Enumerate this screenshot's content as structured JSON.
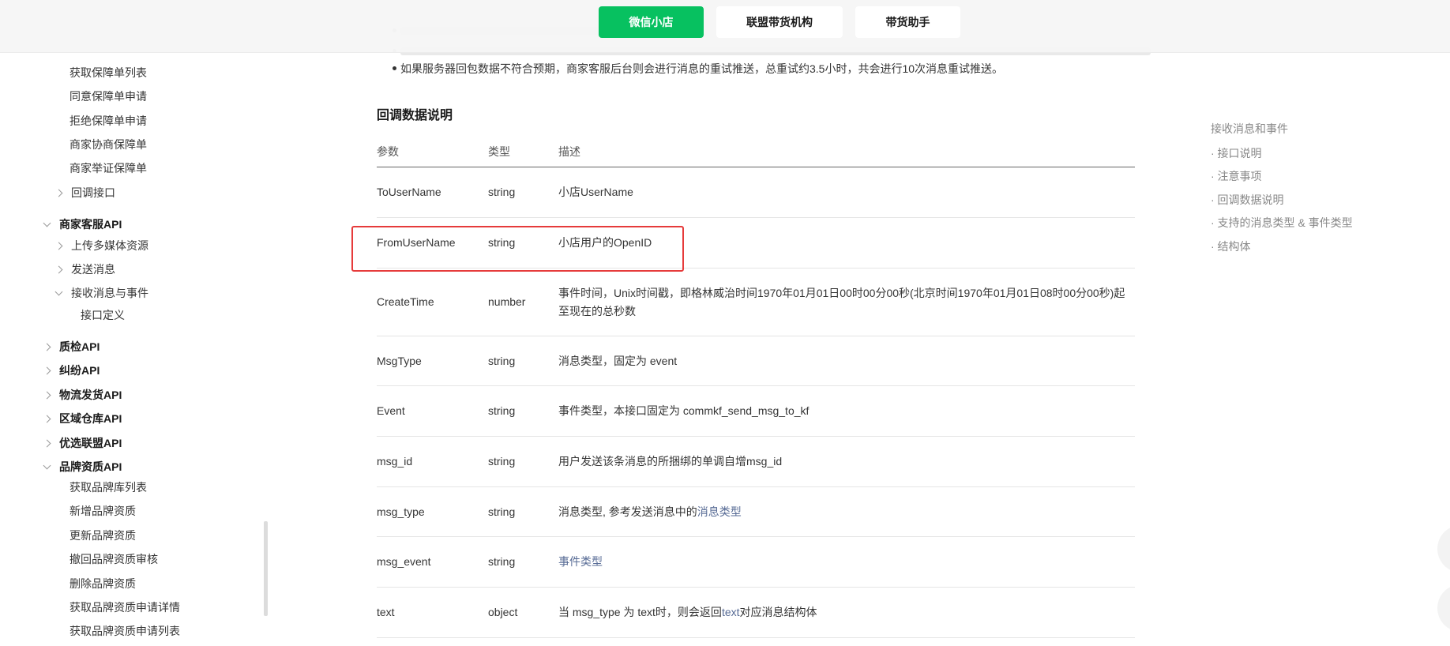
{
  "top_tabs": [
    {
      "label": "微信小店",
      "active": true
    },
    {
      "label": "联盟带货机构",
      "active": false
    },
    {
      "label": "带货助手",
      "active": false
    }
  ],
  "intro": {
    "last_bullet": "如果服务器回包数据不符合预期，商家客服后台则会进行消息的重试推送，总重试约3.5小时，共会进行10次消息重试推送。"
  },
  "sidebar": {
    "items": [
      {
        "label": "获取保障单列表"
      },
      {
        "label": "同意保障单申请"
      },
      {
        "label": "拒绝保障单申请"
      },
      {
        "label": "商家协商保障单"
      },
      {
        "label": "商家举证保障单"
      },
      {
        "label": "回调接口"
      },
      {
        "label": "商家客服API"
      },
      {
        "label": "上传多媒体资源"
      },
      {
        "label": "发送消息"
      },
      {
        "label": "接收消息与事件"
      },
      {
        "label": "接口定义"
      },
      {
        "label": "质检API"
      },
      {
        "label": "纠纷API"
      },
      {
        "label": "物流发货API"
      },
      {
        "label": "区域仓库API"
      },
      {
        "label": "优选联盟API"
      },
      {
        "label": "品牌资质API"
      },
      {
        "label": "获取品牌库列表"
      },
      {
        "label": "新增品牌资质"
      },
      {
        "label": "更新品牌资质"
      },
      {
        "label": "撤回品牌资质审核"
      },
      {
        "label": "删除品牌资质"
      },
      {
        "label": "获取品牌资质申请详情"
      },
      {
        "label": "获取品牌资质申请列表"
      }
    ]
  },
  "section": {
    "title": "回调数据说明",
    "headers": [
      "参数",
      "类型",
      "描述"
    ],
    "rows": [
      {
        "param": "ToUserName",
        "type": "string",
        "desc": "小店UserName"
      },
      {
        "param": "FromUserName",
        "type": "string",
        "desc": "小店用户的OpenID"
      },
      {
        "param": "CreateTime",
        "type": "number",
        "desc": "事件时间，Unix时间戳，即格林威治时间1970年01月01日00时00分00秒(北京时间1970年01月01日08时00分00秒)起至现在的总秒数"
      },
      {
        "param": "MsgType",
        "type": "string",
        "desc": "消息类型，固定为 event"
      },
      {
        "param": "Event",
        "type": "string",
        "desc": "事件类型，本接口固定为 commkf_send_msg_to_kf"
      },
      {
        "param": "msg_id",
        "type": "string",
        "desc": "用户发送该条消息的所捆绑的单调自增msg_id"
      },
      {
        "param": "msg_type",
        "type": "string",
        "desc_prefix": "消息类型, 参考发送消息中的",
        "desc_link": "消息类型"
      },
      {
        "param": "msg_event",
        "type": "string",
        "desc_link": "事件类型"
      },
      {
        "param": "text",
        "type": "object",
        "desc_prefix": "当 msg_type 为 text时，则会返回",
        "desc_link": "text",
        "desc_suffix": "对应消息结构体"
      }
    ]
  },
  "toc": {
    "title": "接收消息和事件",
    "items": [
      "· 接口说明",
      "· 注意事项",
      "· 回调数据说明",
      "· 支持的消息类型 & 事件类型",
      "· 结构体"
    ]
  },
  "colors": {
    "accent": "#07c160",
    "link": "#576b95",
    "highlight": "#e63b3b"
  }
}
